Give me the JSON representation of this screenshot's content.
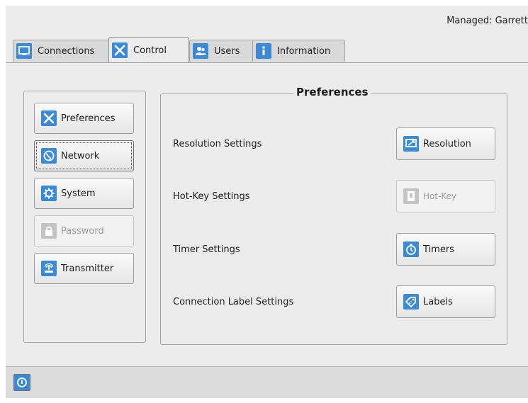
{
  "header": {
    "managed_text": "Managed: Garrett"
  },
  "tabs": [
    {
      "label": "Connections",
      "icon": "monitor-icon",
      "active": false
    },
    {
      "label": "Control",
      "icon": "tools-icon",
      "active": true
    },
    {
      "label": "Users",
      "icon": "users-icon",
      "active": false
    },
    {
      "label": "Information",
      "icon": "info-icon",
      "active": false
    }
  ],
  "sidebar": {
    "items": [
      {
        "label": "Preferences",
        "icon": "tools-icon",
        "enabled": true
      },
      {
        "label": "Network",
        "icon": "globe-icon",
        "enabled": true,
        "focused": true
      },
      {
        "label": "System",
        "icon": "gear-icon",
        "enabled": true
      },
      {
        "label": "Password",
        "icon": "lock-icon",
        "enabled": false
      },
      {
        "label": "Transmitter",
        "icon": "transmitter-icon",
        "enabled": true
      }
    ]
  },
  "preferences": {
    "title": "Preferences",
    "rows": [
      {
        "label": "Resolution Settings",
        "button": "Resolution",
        "icon": "resolution-icon",
        "enabled": true
      },
      {
        "label": "Hot-Key Settings",
        "button": "Hot-Key",
        "icon": "hotkey-icon",
        "enabled": false
      },
      {
        "label": "Timer Settings",
        "button": "Timers",
        "icon": "timer-icon",
        "enabled": true
      },
      {
        "label": "Connection Label Settings",
        "button": "Labels",
        "icon": "label-icon",
        "enabled": true
      }
    ]
  },
  "footer": {
    "icon": "power-menu-icon"
  },
  "colors": {
    "accent": "#3a8ad8",
    "background": "#ececec",
    "border": "#a2a2a2"
  }
}
